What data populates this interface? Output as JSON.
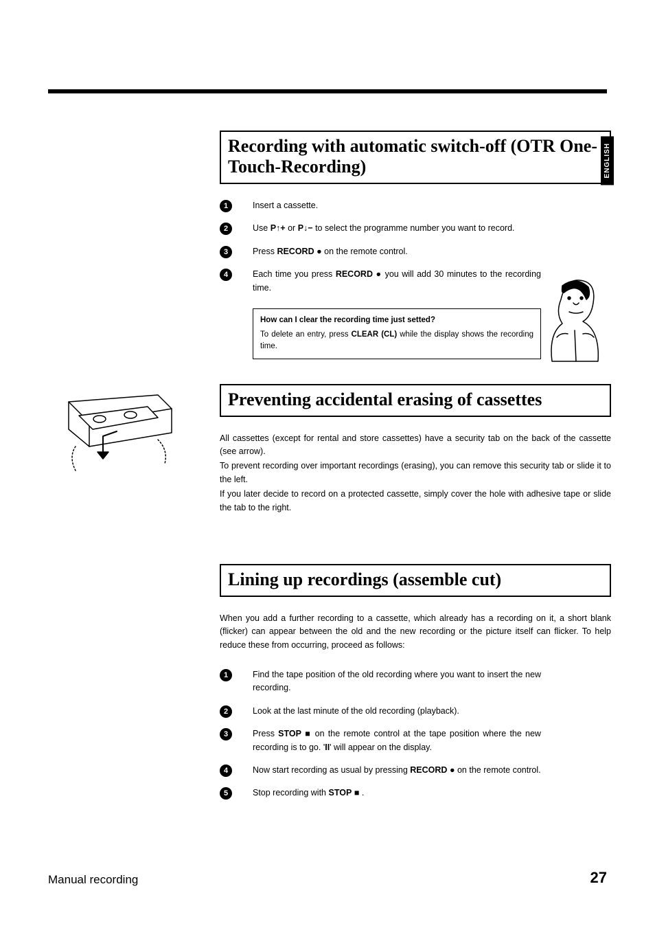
{
  "language_tab": "ENGLISH",
  "section1": {
    "title": "Recording with automatic switch-off (OTR One-Touch-Recording)",
    "steps": [
      {
        "n": "1",
        "pre": "Insert a cassette."
      },
      {
        "n": "2",
        "pre": "Use ",
        "btn1": "P",
        "sym1": "↑+",
        "mid": " or ",
        "btn2": "P",
        "sym2": "↓−",
        "post": " to select the programme number you want to record."
      },
      {
        "n": "3",
        "pre": "Press ",
        "btn1": "RECORD",
        "sym1": "●",
        "post": " on the remote control."
      },
      {
        "n": "4",
        "pre": "Each time you press ",
        "btn1": "RECORD",
        "sym1": "●",
        "post": " you will add 30 minutes to the recording time."
      }
    ],
    "info": {
      "q": "How can I clear the recording time just setted?",
      "a_pre": "To delete an entry, press ",
      "a_btn": "CLEAR (CL)",
      "a_post": " while the display shows the recording time."
    }
  },
  "section2": {
    "title": "Preventing accidental erasing of cassettes",
    "paras": [
      "All cassettes (except for rental and store cassettes) have a security tab on the back of the cassette (see arrow).",
      "To prevent recording over important recordings (erasing), you can remove this security tab or slide it to the left.",
      "If you later decide to record on a protected cassette, simply cover the hole with adhesive tape or slide the tab to the right."
    ]
  },
  "section3": {
    "title": "Lining up recordings (assemble cut)",
    "intro": "When you add a further recording to a cassette, which already has a recording on it, a short blank (flicker) can appear between the old and the new recording or the picture itself can flicker. To help reduce these from occurring, proceed as follows:",
    "steps": [
      {
        "n": "1",
        "pre": "Find the tape position of the old recording where you want to insert the new recording."
      },
      {
        "n": "2",
        "pre": "Look at the last minute of the old recording (playback)."
      },
      {
        "n": "3",
        "pre": "Press ",
        "btn1": "STOP",
        "sym1": "■",
        "mid": " on the remote control at the tape position where the new recording is to go. '",
        "btn2": "II",
        "post": "' will appear on the display."
      },
      {
        "n": "4",
        "pre": "Now start recording as usual by pressing ",
        "btn1": "RECORD",
        "sym1": "●",
        "post": " on the remote control."
      },
      {
        "n": "5",
        "pre": "Stop recording with ",
        "btn1": "STOP",
        "sym1": "■",
        "post": " ."
      }
    ]
  },
  "footer": {
    "title": "Manual recording",
    "page": "27"
  }
}
